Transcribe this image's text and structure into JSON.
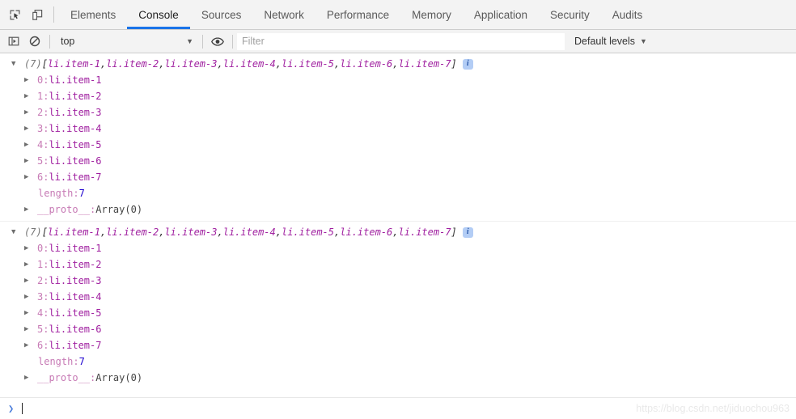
{
  "tabbar": {
    "inspect_icon": "inspect-element-icon",
    "device_icon": "device-toolbar-icon",
    "tabs": [
      {
        "label": "Elements",
        "active": false
      },
      {
        "label": "Console",
        "active": true
      },
      {
        "label": "Sources",
        "active": false
      },
      {
        "label": "Network",
        "active": false
      },
      {
        "label": "Performance",
        "active": false
      },
      {
        "label": "Memory",
        "active": false
      },
      {
        "label": "Application",
        "active": false
      },
      {
        "label": "Security",
        "active": false
      },
      {
        "label": "Audits",
        "active": false
      }
    ],
    "active_tab": "Console",
    "accent_color": "#1a73e8"
  },
  "console_toolbar": {
    "sidebar_icon": "console-sidebar-icon",
    "clear_icon": "clear-console-icon",
    "context_selected": "top",
    "context_caret": "▼",
    "eye_icon": "live-expression-eye-icon",
    "filter_value": "",
    "filter_placeholder": "Filter",
    "levels_label": "Default levels",
    "levels_caret": "▼"
  },
  "console": {
    "groups": [
      {
        "header": {
          "count": "(7)",
          "open_bracket": "[",
          "items": [
            "li.item-1",
            "li.item-2",
            "li.item-3",
            "li.item-4",
            "li.item-5",
            "li.item-6",
            "li.item-7"
          ],
          "separator": ", ",
          "close_bracket": "]",
          "badge": "i"
        },
        "entries": [
          {
            "index": "0:",
            "value": "li.item-1"
          },
          {
            "index": "1:",
            "value": "li.item-2"
          },
          {
            "index": "2:",
            "value": "li.item-3"
          },
          {
            "index": "3:",
            "value": "li.item-4"
          },
          {
            "index": "4:",
            "value": "li.item-5"
          },
          {
            "index": "5:",
            "value": "li.item-6"
          },
          {
            "index": "6:",
            "value": "li.item-7"
          }
        ],
        "length_key": "length:",
        "length_value": "7",
        "proto_key": "__proto__:",
        "proto_value": "Array(0)"
      },
      {
        "header": {
          "count": "(7)",
          "open_bracket": "[",
          "items": [
            "li.item-1",
            "li.item-2",
            "li.item-3",
            "li.item-4",
            "li.item-5",
            "li.item-6",
            "li.item-7"
          ],
          "separator": ", ",
          "close_bracket": "]",
          "badge": "i"
        },
        "entries": [
          {
            "index": "0:",
            "value": "li.item-1"
          },
          {
            "index": "1:",
            "value": "li.item-2"
          },
          {
            "index": "2:",
            "value": "li.item-3"
          },
          {
            "index": "3:",
            "value": "li.item-4"
          },
          {
            "index": "4:",
            "value": "li.item-5"
          },
          {
            "index": "5:",
            "value": "li.item-6"
          },
          {
            "index": "6:",
            "value": "li.item-7"
          }
        ],
        "length_key": "length:",
        "length_value": "7",
        "proto_key": "__proto__:",
        "proto_value": "Array(0)"
      }
    ]
  },
  "prompt": {
    "chevron": "❯",
    "value": ""
  },
  "watermark": {
    "text": "https://blog.csdn.net/jiduochou963"
  },
  "colors": {
    "node_purple": "#a020a0",
    "property_rose": "#c77ab5",
    "number_blue": "#1c00cf",
    "badge_bg": "#b3cdf5",
    "accent": "#1a73e8"
  }
}
